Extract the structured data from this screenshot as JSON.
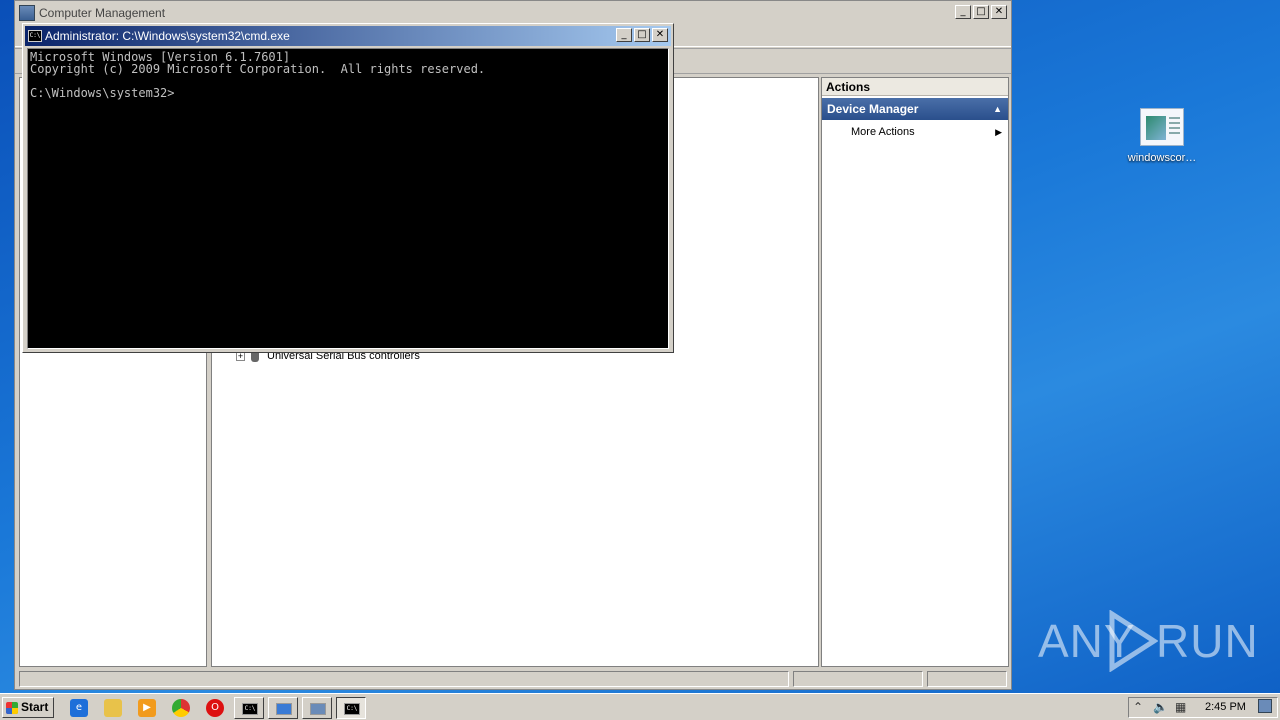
{
  "desktop": {
    "icon_label": "windowscor…",
    "watermark_left": "ANY",
    "watermark_right": "RUN"
  },
  "mmc": {
    "title": "Computer Management",
    "actions_header": "Actions",
    "actions_section": "Device Manager",
    "actions_item": "More Actions",
    "tree_item": "Universal Serial Bus controllers"
  },
  "cmd": {
    "title": "Administrator: C:\\Windows\\system32\\cmd.exe",
    "console_text": "Microsoft Windows [Version 6.1.7601]\nCopyright (c) 2009 Microsoft Corporation.  All rights reserved.\n\nC:\\Windows\\system32>"
  },
  "taskbar": {
    "start_label": "Start",
    "clock": "2:45 PM"
  },
  "colors": {
    "desktop_blue": "#1a78d8",
    "titlebar_active": "#0a246a",
    "actions_section": "#2a4f8c"
  }
}
